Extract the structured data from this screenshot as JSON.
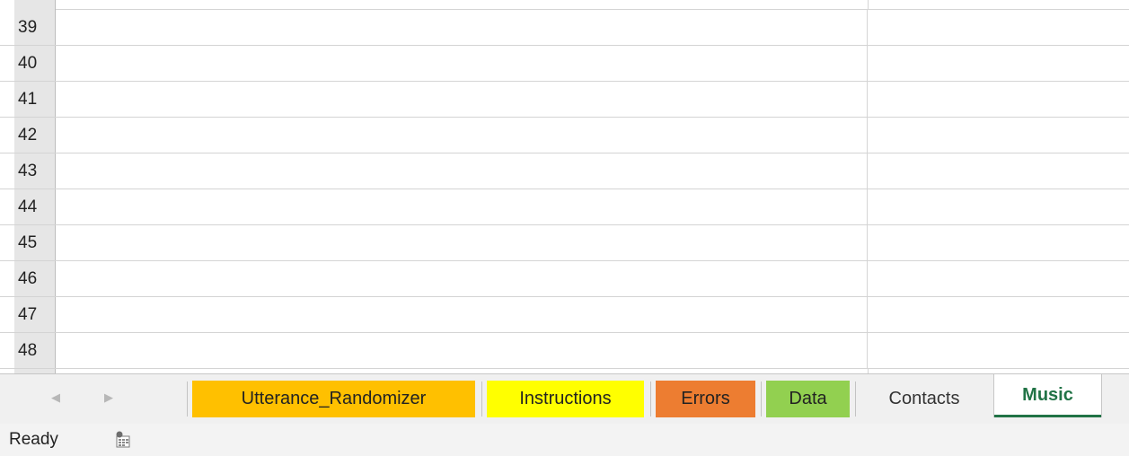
{
  "grid": {
    "rows": [
      "39",
      "40",
      "41",
      "42",
      "43",
      "44",
      "45",
      "46",
      "47",
      "48"
    ]
  },
  "tabbar": {
    "prev_icon": "triangle-left-icon",
    "next_icon": "triangle-right-icon",
    "tabs": [
      {
        "label": "Utterance_Randomizer",
        "color": "#FFC000"
      },
      {
        "label": "Instructions",
        "color": "#FFFF00"
      },
      {
        "label": "Errors",
        "color": "#ED7D31"
      },
      {
        "label": "Data",
        "color": "#92D050"
      },
      {
        "label": "Contacts",
        "color": ""
      },
      {
        "label": "Music",
        "color": "#217346",
        "active": true
      }
    ]
  },
  "status": {
    "text": "Ready",
    "macro_icon": "macro-recording-icon"
  }
}
